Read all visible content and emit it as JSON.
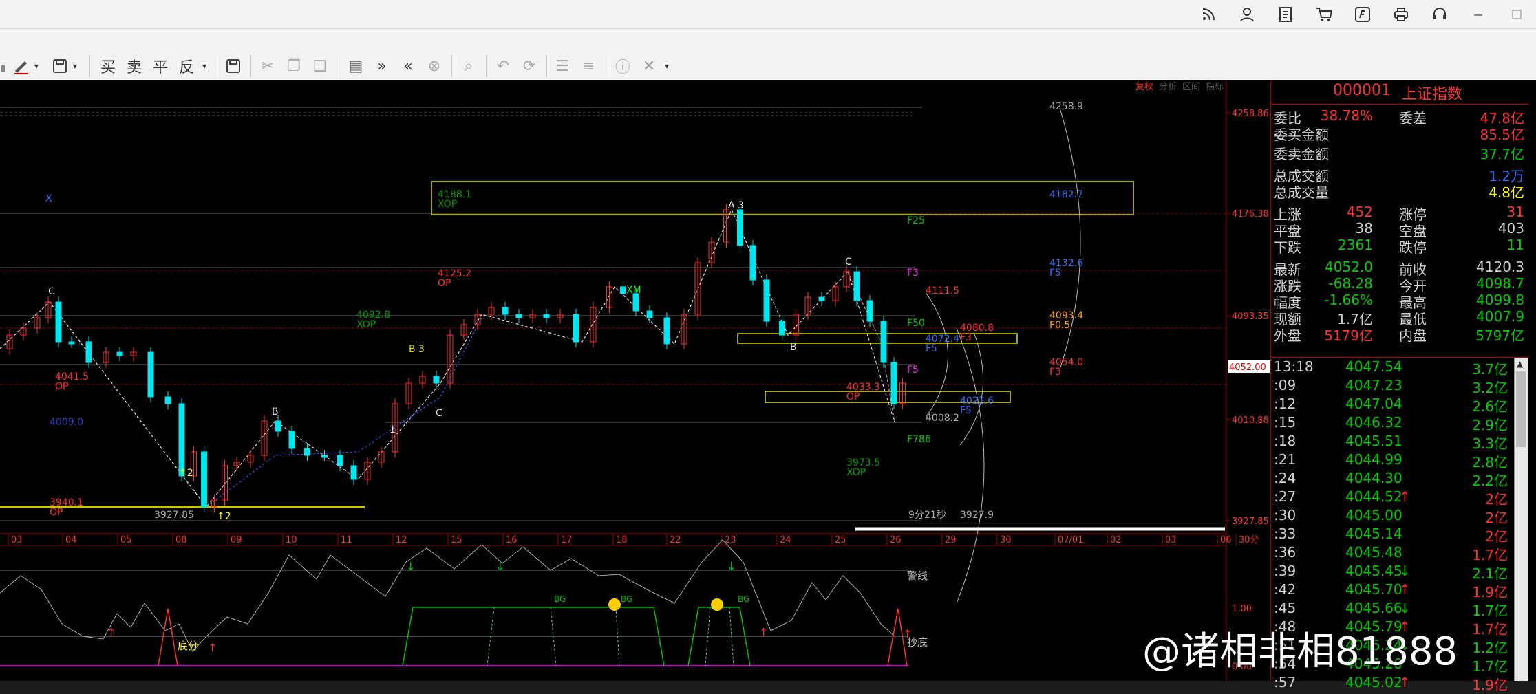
{
  "colors": {
    "up": "#ff3030",
    "down": "#00e5ee",
    "green": "#00d000",
    "yellow": "#ffff00",
    "blue": "#3070ff",
    "magenta": "#ff30ff",
    "grid": "#8b0000"
  },
  "topbar": {
    "icons": [
      "rss-icon",
      "user-icon",
      "document-icon",
      "cart-icon",
      "stock-logo-icon",
      "printer-icon",
      "headset-icon",
      "minimize-icon",
      "maximize-icon"
    ]
  },
  "toolbar": {
    "buy": "买",
    "sell": "卖",
    "flat": "平",
    "reverse": "反"
  },
  "chart_labels": {
    "p4258": "4258.9",
    "p4188": "4188.1",
    "xop": "XOP",
    "p4125": "4125.2",
    "op": "OP",
    "p4092": "4092.8",
    "p4041": "4041.5",
    "p3940": "3940.1",
    "p3927b": "3927.85",
    "p4009": "4009.0",
    "p4111": "4111.5",
    "p4080": "4080.8",
    "p4093": "4093.4",
    "p4054": "4054.0",
    "p4033": "4033.3",
    "p4072": "4072.4",
    "p4022": "4022.6",
    "p4008": "4008.2",
    "p3973": "3973.5",
    "p3927": "3927.9",
    "p4132": "4132.6",
    "p4182": "4182.7",
    "f25": "F25",
    "f3": "F3",
    "f50": "F50",
    "f5": "F5",
    "f786": "F786",
    "f05": "F0.5",
    "time_left": "9分21秒",
    "fib_a": "A",
    "fib_b": "B",
    "fib_c": "C",
    "fib_x": "X",
    "b3": "B 3",
    "a3": "A 3",
    "xm": "XM",
    "one": "1",
    "two": "2",
    "up2": "↑2",
    "tabs": [
      "复权",
      "分析",
      "区间",
      "指标"
    ]
  },
  "price_axis": {
    "ticks": [
      "4258.86",
      "4176.38",
      "4093.35",
      "4010.88",
      "3927.85"
    ],
    "current": "4052.00"
  },
  "date_axis": [
    "03",
    "04",
    "05",
    "08",
    "09",
    "10",
    "11",
    "12",
    "15",
    "16",
    "17",
    "18",
    "22",
    "23",
    "24",
    "25",
    "26",
    "29",
    "30",
    "07/01",
    "02",
    "03",
    "06",
    "30分"
  ],
  "indicator": {
    "warn": "警线",
    "bottom": "底分",
    "copy_bottom": "抄底",
    "bg": "BG",
    "level_1": "1.00",
    "level_0": "0.00"
  },
  "quote": {
    "code": "000001",
    "name": "上证指数",
    "rows": [
      {
        "k1": "委比",
        "v1": "38.78%",
        "k2": "委差",
        "v2": "47.8亿",
        "c1": "#ff3030",
        "c2": "#ff3030"
      },
      {
        "k1": "委买金额",
        "v1": "",
        "k2": "",
        "v2": "85.5亿",
        "c2": "#ff3030"
      },
      {
        "k1": "委卖金额",
        "v1": "",
        "k2": "",
        "v2": "37.7亿",
        "c2": "#00d000"
      },
      {
        "k1": "总成交额",
        "v1": "",
        "k2": "",
        "v2": "1.2万",
        "c2": "#3070ff"
      },
      {
        "k1": "总成交量",
        "v1": "",
        "k2": "",
        "v2": "4.8亿",
        "c2": "#ffff00"
      },
      {
        "k1": "上涨",
        "v1": "452",
        "k2": "涨停",
        "v2": "31",
        "c1": "#ff3030",
        "c2": "#ff3030"
      },
      {
        "k1": "平盘",
        "v1": "38",
        "k2": "空盘",
        "v2": "403",
        "c1": "#d0d0d0",
        "c2": "#d0d0d0"
      },
      {
        "k1": "下跌",
        "v1": "2361",
        "k2": "跌停",
        "v2": "11",
        "c1": "#00d000",
        "c2": "#00d000"
      },
      {
        "k1": "最新",
        "v1": "4052.0",
        "k2": "前收",
        "v2": "4120.3",
        "c1": "#00d000",
        "c2": "#d0d0d0"
      },
      {
        "k1": "涨跌",
        "v1": "-68.28",
        "k2": "今开",
        "v2": "4098.7",
        "c1": "#00d000",
        "c2": "#00d000"
      },
      {
        "k1": "幅度",
        "v1": "-1.66%",
        "k2": "最高",
        "v2": "4099.8",
        "c1": "#00d000",
        "c2": "#00d000"
      },
      {
        "k1": "现额",
        "v1": "1.7亿",
        "k2": "最低",
        "v2": "4007.9",
        "c1": "#d0d0d0",
        "c2": "#00d000"
      },
      {
        "k1": "外盘",
        "v1": "5179亿",
        "k2": "内盘",
        "v2": "5797亿",
        "c1": "#ff3030",
        "c2": "#00d000"
      }
    ]
  },
  "ticks": [
    {
      "t": "13:18",
      "p": "4047.54",
      "a": "",
      "v": "3.7亿",
      "vc": "#00d000"
    },
    {
      "t": ":09",
      "p": "4047.23",
      "a": "",
      "v": "3.2亿",
      "vc": "#00d000"
    },
    {
      "t": ":12",
      "p": "4047.04",
      "a": "",
      "v": "2.6亿",
      "vc": "#00d000"
    },
    {
      "t": ":15",
      "p": "4046.32",
      "a": "",
      "v": "2.9亿",
      "vc": "#00d000"
    },
    {
      "t": ":18",
      "p": "4045.51",
      "a": "",
      "v": "3.3亿",
      "vc": "#00d000"
    },
    {
      "t": ":21",
      "p": "4044.99",
      "a": "",
      "v": "2.8亿",
      "vc": "#00d000"
    },
    {
      "t": ":24",
      "p": "4044.30",
      "a": "",
      "v": "2.2亿",
      "vc": "#00d000"
    },
    {
      "t": ":27",
      "p": "4044.52",
      "a": "↑",
      "v": "2亿",
      "vc": "#ff3030"
    },
    {
      "t": ":30",
      "p": "4045.00",
      "a": "",
      "v": "2亿",
      "vc": "#ff3030"
    },
    {
      "t": ":33",
      "p": "4045.14",
      "a": "",
      "v": "2亿",
      "vc": "#ff3030"
    },
    {
      "t": ":36",
      "p": "4045.48",
      "a": "",
      "v": "1.7亿",
      "vc": "#ff3030"
    },
    {
      "t": ":39",
      "p": "4045.45",
      "a": "↓",
      "v": "2.1亿",
      "vc": "#00d000"
    },
    {
      "t": ":42",
      "p": "4045.70",
      "a": "↑",
      "v": "1.9亿",
      "vc": "#ff3030"
    },
    {
      "t": ":45",
      "p": "4045.66",
      "a": "↓",
      "v": "1.7亿",
      "vc": "#00d000"
    },
    {
      "t": ":48",
      "p": "4045.79",
      "a": "↑",
      "v": "1.7亿",
      "vc": "#ff3030"
    },
    {
      "t": ":51",
      "p": "4045.24",
      "a": "↓",
      "v": "1.2亿",
      "vc": "#00d000"
    },
    {
      "t": ":54",
      "p": "4045.26",
      "a": "",
      "v": "1.7亿",
      "vc": "#00d000"
    },
    {
      "t": ":57",
      "p": "4045.02",
      "a": "↑",
      "v": "1.9亿",
      "vc": "#ff3030"
    }
  ],
  "watermark": "@诸相非相81888"
}
